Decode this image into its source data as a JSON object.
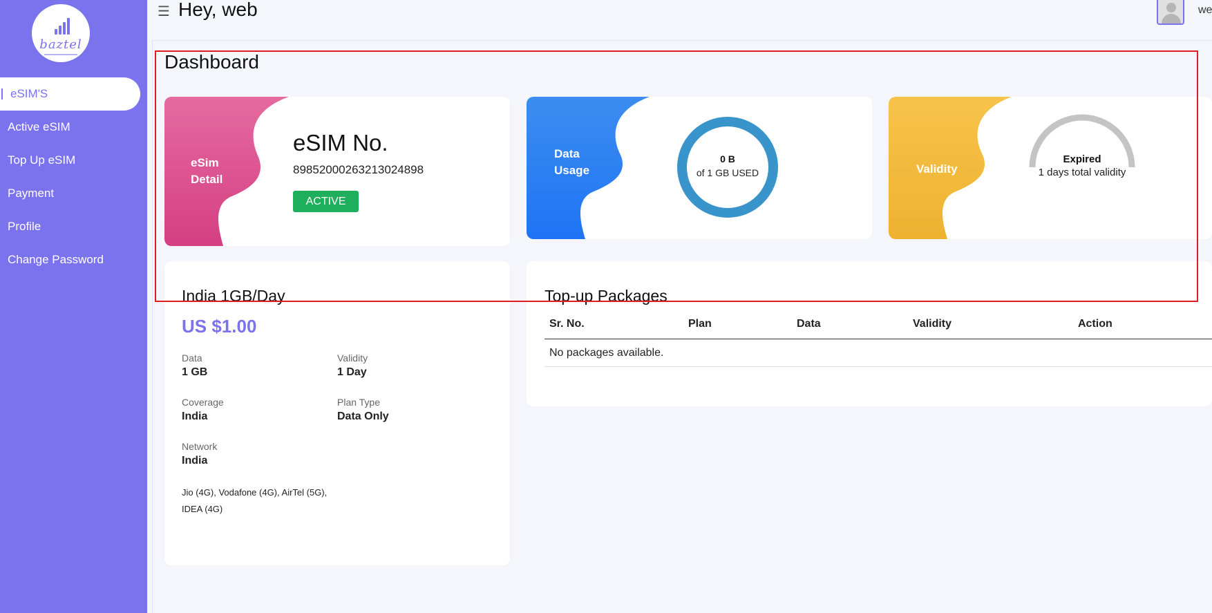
{
  "brand": {
    "name": "baztel"
  },
  "sidebar": {
    "items": [
      {
        "label": "eSIM'S",
        "active": true
      },
      {
        "label": "Active eSIM"
      },
      {
        "label": "Top Up eSIM"
      },
      {
        "label": "Payment"
      },
      {
        "label": "Profile"
      },
      {
        "label": "Change Password"
      }
    ]
  },
  "header": {
    "greeting": "Hey, web",
    "username": "we",
    "menu_icon": "hamburger-icon",
    "avatar_icon": "user-avatar-icon"
  },
  "page": {
    "title": "Dashboard"
  },
  "esim_card": {
    "label": "eSim Detail",
    "title": "eSIM No.",
    "iccid": "89852000263213024898",
    "status": "ACTIVE"
  },
  "data_card": {
    "label": "Data Usage",
    "used": "0 B",
    "of_text": "of 1 GB USED",
    "usage_fraction": 0
  },
  "validity_card": {
    "label": "Validity",
    "status": "Expired",
    "sub": "1 days total validity"
  },
  "plan": {
    "name": "India 1GB/Day",
    "price": "US $1.00",
    "data_label": "Data",
    "data_value": "1 GB",
    "validity_label": "Validity",
    "validity_value": "1 Day",
    "coverage_label": "Coverage",
    "coverage_value": "India",
    "type_label": "Plan Type",
    "type_value": "Data Only",
    "network_label": "Network",
    "network_value": "India",
    "networks": "Jio (4G), Vodafone (4G), AirTel (5G), IDEA (4G)"
  },
  "topup": {
    "title": "Top-up Packages",
    "columns": [
      "Sr. No.",
      "Plan",
      "Data",
      "Validity",
      "Action"
    ],
    "empty_text": "No packages available."
  },
  "colors": {
    "sidebar": "#7b72ee",
    "esim_blob": "#de4d8c",
    "data_blob": "#2a7ef2",
    "validity_blob": "#f3b93a",
    "ring": "#3a94cc",
    "gauge": "#c4c4c4",
    "active_badge": "#1fae5b",
    "highlight": "#e01b22"
  }
}
